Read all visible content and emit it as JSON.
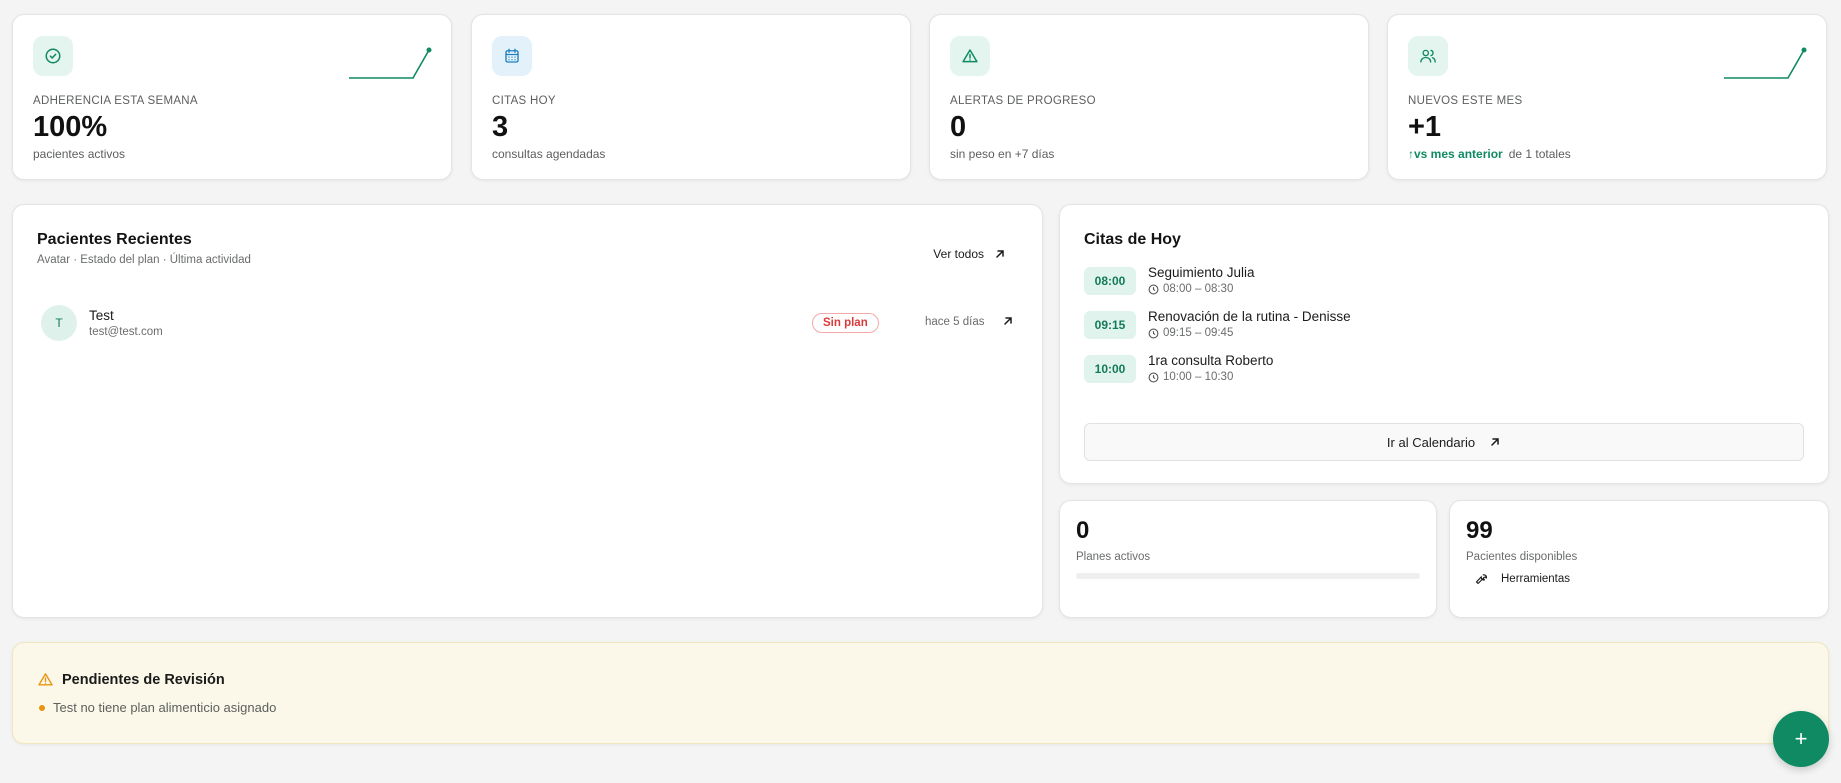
{
  "stats": [
    {
      "icon": "check-circle-icon",
      "label": "ADHERENCIA ESTA SEMANA",
      "value": "100%",
      "sub": "pacientes activos"
    },
    {
      "icon": "calendar-icon",
      "label": "CITAS HOY",
      "value": "3",
      "sub": "consultas agendadas"
    },
    {
      "icon": "alert-triangle-icon",
      "label": "ALERTAS DE PROGRESO",
      "value": "0",
      "sub": "sin peso en +7 días"
    },
    {
      "icon": "users-icon",
      "label": "NUEVOS ESTE MES",
      "value": "+1",
      "sub_highlight": "↑vs mes anterior",
      "sub": "de 1 totales"
    }
  ],
  "recent": {
    "title": "Pacientes Recientes",
    "subtitle": "Avatar · Estado del plan · Última actividad",
    "view_all": "Ver todos",
    "patients": [
      {
        "initial": "T",
        "name": "Test",
        "email": "test@test.com",
        "badge": "Sin plan",
        "last_activity": "hace 5 días"
      }
    ]
  },
  "citas": {
    "title": "Citas de Hoy",
    "items": [
      {
        "time": "08:00",
        "title": "Seguimiento Julia",
        "range": "08:00 – 08:30"
      },
      {
        "time": "09:15",
        "title": "Renovación de la rutina - Denisse",
        "range": "09:15 – 09:45"
      },
      {
        "time": "10:00",
        "title": "1ra consulta Roberto",
        "range": "10:00 – 10:30"
      }
    ],
    "calendar_button": "Ir al Calendario"
  },
  "planes": {
    "value": "0",
    "label": "Planes activos",
    "progress_fraction": 0
  },
  "disponibles": {
    "value": "99",
    "label": "Pacientes disponibles",
    "tools": "Herramientas"
  },
  "pending": {
    "title": "Pendientes de Revisión",
    "items": [
      "Test no tiene plan alimenticio asignado"
    ]
  },
  "fab": {
    "label": "+"
  },
  "colors": {
    "accent": "#0f8a63",
    "warning": "#e8940f",
    "danger": "#d93a3a",
    "background": "#f3f4f3"
  }
}
